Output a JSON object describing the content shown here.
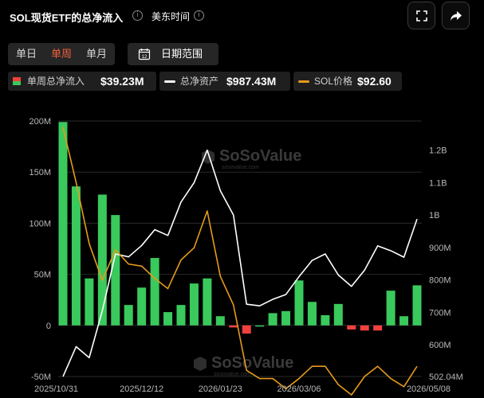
{
  "header": {
    "title": "SOL现货ETF的总净流入",
    "info_glyph": "i",
    "timezone": "美东时间"
  },
  "tabs": [
    {
      "label": "单日",
      "active": false
    },
    {
      "label": "单周",
      "active": true
    },
    {
      "label": "单月",
      "active": false
    }
  ],
  "date_range": {
    "label": "日期范围",
    "calendar_day": "12"
  },
  "legend": [
    {
      "name": "单周总净流入",
      "value": "$39.23M",
      "color": "#3ac95c"
    },
    {
      "name": "总净资产",
      "value": "$987.43M",
      "color": "#ffffff"
    },
    {
      "name": "SOL价格",
      "value": "$92.60",
      "color": "#e69a1c"
    }
  ],
  "icons": {
    "fullscreen": "fullscreen-icon",
    "share": "share-icon"
  },
  "watermark": {
    "text": "SoSoValue",
    "sub": "sosovalue.com"
  },
  "colors": {
    "positive": "#3ac95c",
    "negative": "#f1413e",
    "assets": "#ffffff",
    "price": "#e69a1c",
    "accent": "#f2603d"
  },
  "chart_data": {
    "type": "bar",
    "x": [
      "2025/10/31",
      "2025/11/07",
      "2025/11/14",
      "2025/11/21",
      "2025/11/28",
      "2025/12/05",
      "2025/12/12",
      "2025/12/19",
      "2025/12/26",
      "2026/01/02",
      "2026/01/09",
      "2026/01/16",
      "2026/01/23",
      "2026/01/30",
      "2026/02/06",
      "2026/02/13",
      "2026/02/20",
      "2026/02/27",
      "2026/03/06",
      "2026/03/13",
      "2026/03/20",
      "2026/03/27",
      "2026/04/03",
      "2026/04/10",
      "2026/04/17",
      "2026/04/24",
      "2026/05/01",
      "2026/05/08"
    ],
    "x_tick_labels": [
      "2025/10/31",
      "2025/12/12",
      "2026/01/23",
      "2026/03/06",
      "2026/05/08"
    ],
    "left_axis": {
      "ylim": [
        -50,
        200
      ],
      "ticks": [
        "200M",
        "150M",
        "100M",
        "50M",
        "0",
        "-50M"
      ],
      "tick_values": [
        200,
        150,
        100,
        50,
        0,
        -50
      ]
    },
    "right_axis": {
      "ylim": [
        502.04,
        1290
      ],
      "ticks": [
        "1.2B",
        "1.1B",
        "1B",
        "900M",
        "800M",
        "700M",
        "600M",
        "502.04M"
      ],
      "tick_values": [
        1200,
        1100,
        1000,
        900,
        800,
        700,
        600,
        502.04
      ]
    },
    "series": [
      {
        "name": "单周总净流入",
        "type": "bar",
        "axis": "left",
        "unit": "M",
        "values": [
          199,
          136,
          46,
          128,
          108,
          20,
          37,
          66,
          13,
          20,
          41,
          46,
          9,
          -2,
          -8,
          0,
          12,
          14,
          44,
          23,
          10,
          21,
          -4,
          -5,
          -5,
          34,
          9,
          39.23
        ]
      },
      {
        "name": "总净资产",
        "type": "line",
        "axis": "right",
        "unit": "M",
        "values": [
          502,
          594,
          560,
          705,
          880,
          871,
          906,
          955,
          937,
          1040,
          1100,
          1200,
          1075,
          1000,
          725,
          720,
          740,
          755,
          810,
          860,
          880,
          815,
          780,
          830,
          905,
          890,
          870,
          987.43
        ]
      },
      {
        "name": "SOL价格",
        "type": "line",
        "axis": "right_price",
        "unit": "$",
        "price_scale": {
          "ylim": [
            115,
            240
          ]
        },
        "values": [
          237,
          210,
          180,
          162,
          177,
          170,
          169,
          163,
          158,
          172,
          178,
          196,
          164,
          150,
          118,
          114,
          114,
          109,
          114,
          120,
          120,
          111,
          106,
          115,
          120,
          114,
          110,
          120
        ]
      }
    ],
    "grid": true,
    "legend_position": "top"
  }
}
